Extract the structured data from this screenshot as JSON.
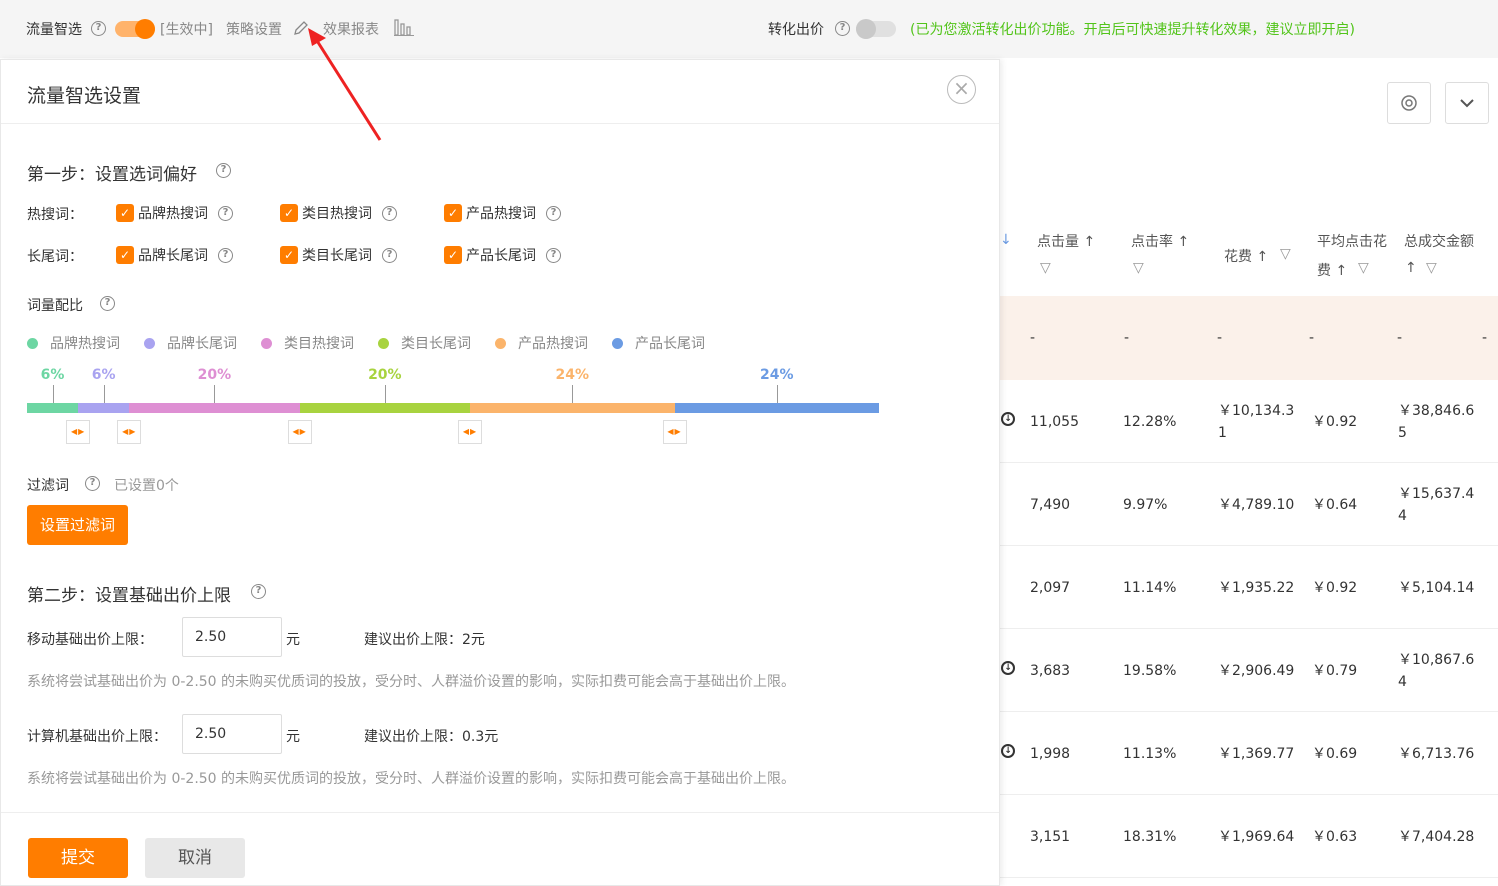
{
  "topbar": {
    "traffic_label": "流量智选",
    "status": "[生效中]",
    "strategy": "策略设置",
    "report": "效果报表",
    "conv_label": "转化出价",
    "conv_tip": "(已为您激活转化出价功能。开启后可快速提升转化效果，建议立即开启)"
  },
  "modal": {
    "title": "流量智选设置",
    "close": "×",
    "step1_title": "第一步：设置选词偏好",
    "hot_label": "热搜词：",
    "long_label": "长尾词：",
    "hot_items": [
      "品牌热搜词",
      "类目热搜词",
      "产品热搜词"
    ],
    "long_items": [
      "品牌长尾词",
      "类目长尾词",
      "产品长尾词"
    ],
    "ratio_label": "词量配比",
    "legend": [
      "品牌热搜词",
      "品牌长尾词",
      "类目热搜词",
      "类目长尾词",
      "产品热搜词",
      "产品长尾词"
    ],
    "legend_colors": [
      "#6dd6a3",
      "#a9a3f0",
      "#de8fd3",
      "#a8d33f",
      "#fbb46b",
      "#6b9be3"
    ],
    "ratio_values": [
      "6%",
      "6%",
      "20%",
      "20%",
      "24%",
      "24%"
    ],
    "ratio_fractions": [
      0.06,
      0.06,
      0.2,
      0.2,
      0.24,
      0.24
    ],
    "filter_label": "过滤词",
    "filter_count": "已设置0个",
    "filter_btn": "设置过滤词",
    "step2_title": "第二步：设置基础出价上限",
    "mobile_label": "移动基础出价上限：",
    "mobile_value": "2.50",
    "unit": "元",
    "mobile_suggest": "建议出价上限：2元",
    "mobile_hint": "系统将尝试基础出价为 0-2.50 的未购买优质词的投放，受分时、人群溢价设置的影响，实际扣费可能会高于基础出价上限。",
    "pc_label": "计算机基础出价上限：",
    "pc_value": "2.50",
    "pc_suggest": "建议出价上限：0.3元",
    "pc_hint": "系统将尝试基础出价为 0-2.50 的未购买优质词的投放，受分时、人群溢价设置的影响，实际扣费可能会高于基础出价上限。",
    "submit": "提交",
    "cancel": "取消"
  },
  "table": {
    "headers": [
      "点击量 ↑",
      "点击率 ↑",
      "花费 ↑",
      "平均点击花",
      "费 ↑",
      "总成交金额",
      "↑"
    ],
    "summary": [
      "-",
      "-",
      "-",
      "-",
      "-",
      "-"
    ],
    "rows": [
      {
        "clicks": "11,055",
        "ctr": "12.28%",
        "cost": "￥10,134.3",
        "cost2": "1",
        "cpc": "￥0.92",
        "gmv": "￥38,846.6",
        "gmv2": "5",
        "dl": true
      },
      {
        "clicks": "7,490",
        "ctr": "9.97%",
        "cost": "￥4,789.10",
        "cost2": "",
        "cpc": "￥0.64",
        "gmv": "￥15,637.4",
        "gmv2": "4",
        "dl": false
      },
      {
        "clicks": "2,097",
        "ctr": "11.14%",
        "cost": "￥1,935.22",
        "cost2": "",
        "cpc": "￥0.92",
        "gmv": "￥5,104.14",
        "gmv2": "",
        "dl": false
      },
      {
        "clicks": "3,683",
        "ctr": "19.58%",
        "cost": "￥2,906.49",
        "cost2": "",
        "cpc": "￥0.79",
        "gmv": "￥10,867.6",
        "gmv2": "4",
        "dl": true
      },
      {
        "clicks": "1,998",
        "ctr": "11.13%",
        "cost": "￥1,369.77",
        "cost2": "",
        "cpc": "￥0.69",
        "gmv": "￥6,713.76",
        "gmv2": "",
        "dl": true
      },
      {
        "clicks": "3,151",
        "ctr": "18.31%",
        "cost": "￥1,969.64",
        "cost2": "",
        "cpc": "￥0.63",
        "gmv": "￥7,404.28",
        "gmv2": "",
        "dl": false
      }
    ]
  }
}
